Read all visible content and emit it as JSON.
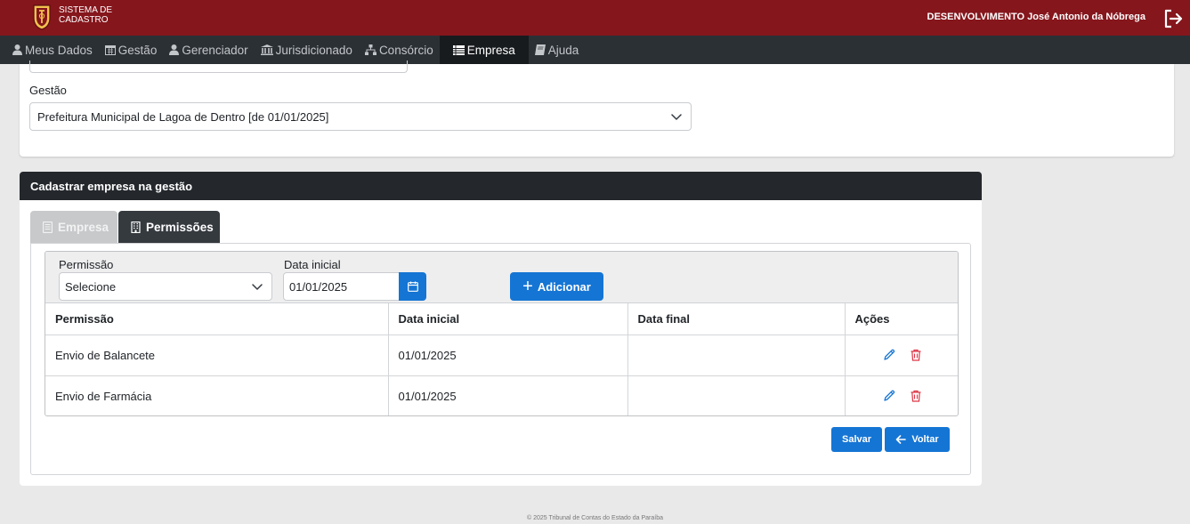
{
  "header": {
    "brand_line1": "SISTEMA DE",
    "brand_line2": "CADASTRO",
    "user": "DESENVOLVIMENTO José Antonio da Nóbrega",
    "logo_icon": "shield-logo",
    "logout_icon": "logout-icon",
    "colors": {
      "header_bg": "#85161c",
      "nav_bg": "#2b3035"
    }
  },
  "nav": {
    "items": [
      {
        "label": "Meus Dados",
        "icon": "user-icon"
      },
      {
        "label": "Gestão",
        "icon": "calendar-icon"
      },
      {
        "label": "Gerenciador",
        "icon": "user-icon"
      },
      {
        "label": "Jurisdicionado",
        "icon": "bank-icon"
      },
      {
        "label": "Consórcio",
        "icon": "sitemap-icon"
      },
      {
        "label": "Empresa",
        "icon": "list-icon",
        "active": true
      },
      {
        "label": "Ajuda",
        "icon": "book-icon"
      }
    ]
  },
  "gestao": {
    "label": "Gestão",
    "selected": "Prefeitura Municipal de Lagoa de Dentro [de 01/01/2025]"
  },
  "card": {
    "title": "Cadastrar empresa na gestão",
    "tabs": [
      {
        "label": "Empresa",
        "icon": "document-icon",
        "active": false
      },
      {
        "label": "Permissões",
        "icon": "building-icon",
        "active": true
      }
    ]
  },
  "form": {
    "permissao_label": "Permissão",
    "permissao_selected": "Selecione",
    "data_label": "Data inicial",
    "data_value": "01/01/2025",
    "add_label": "Adicionar"
  },
  "table": {
    "headers": [
      "Permissão",
      "Data inicial",
      "Data final",
      "Ações"
    ],
    "rows": [
      {
        "permissao": "Envio de Balancete",
        "data_inicial": "01/01/2025",
        "data_final": ""
      },
      {
        "permissao": "Envio de Farmácia",
        "data_inicial": "01/01/2025",
        "data_final": ""
      }
    ]
  },
  "buttons": {
    "salvar": "Salvar",
    "voltar": "Voltar",
    "accent": "#1575d4"
  },
  "footer": "© 2025 Tribunal de Contas do Estado da Paraíba"
}
